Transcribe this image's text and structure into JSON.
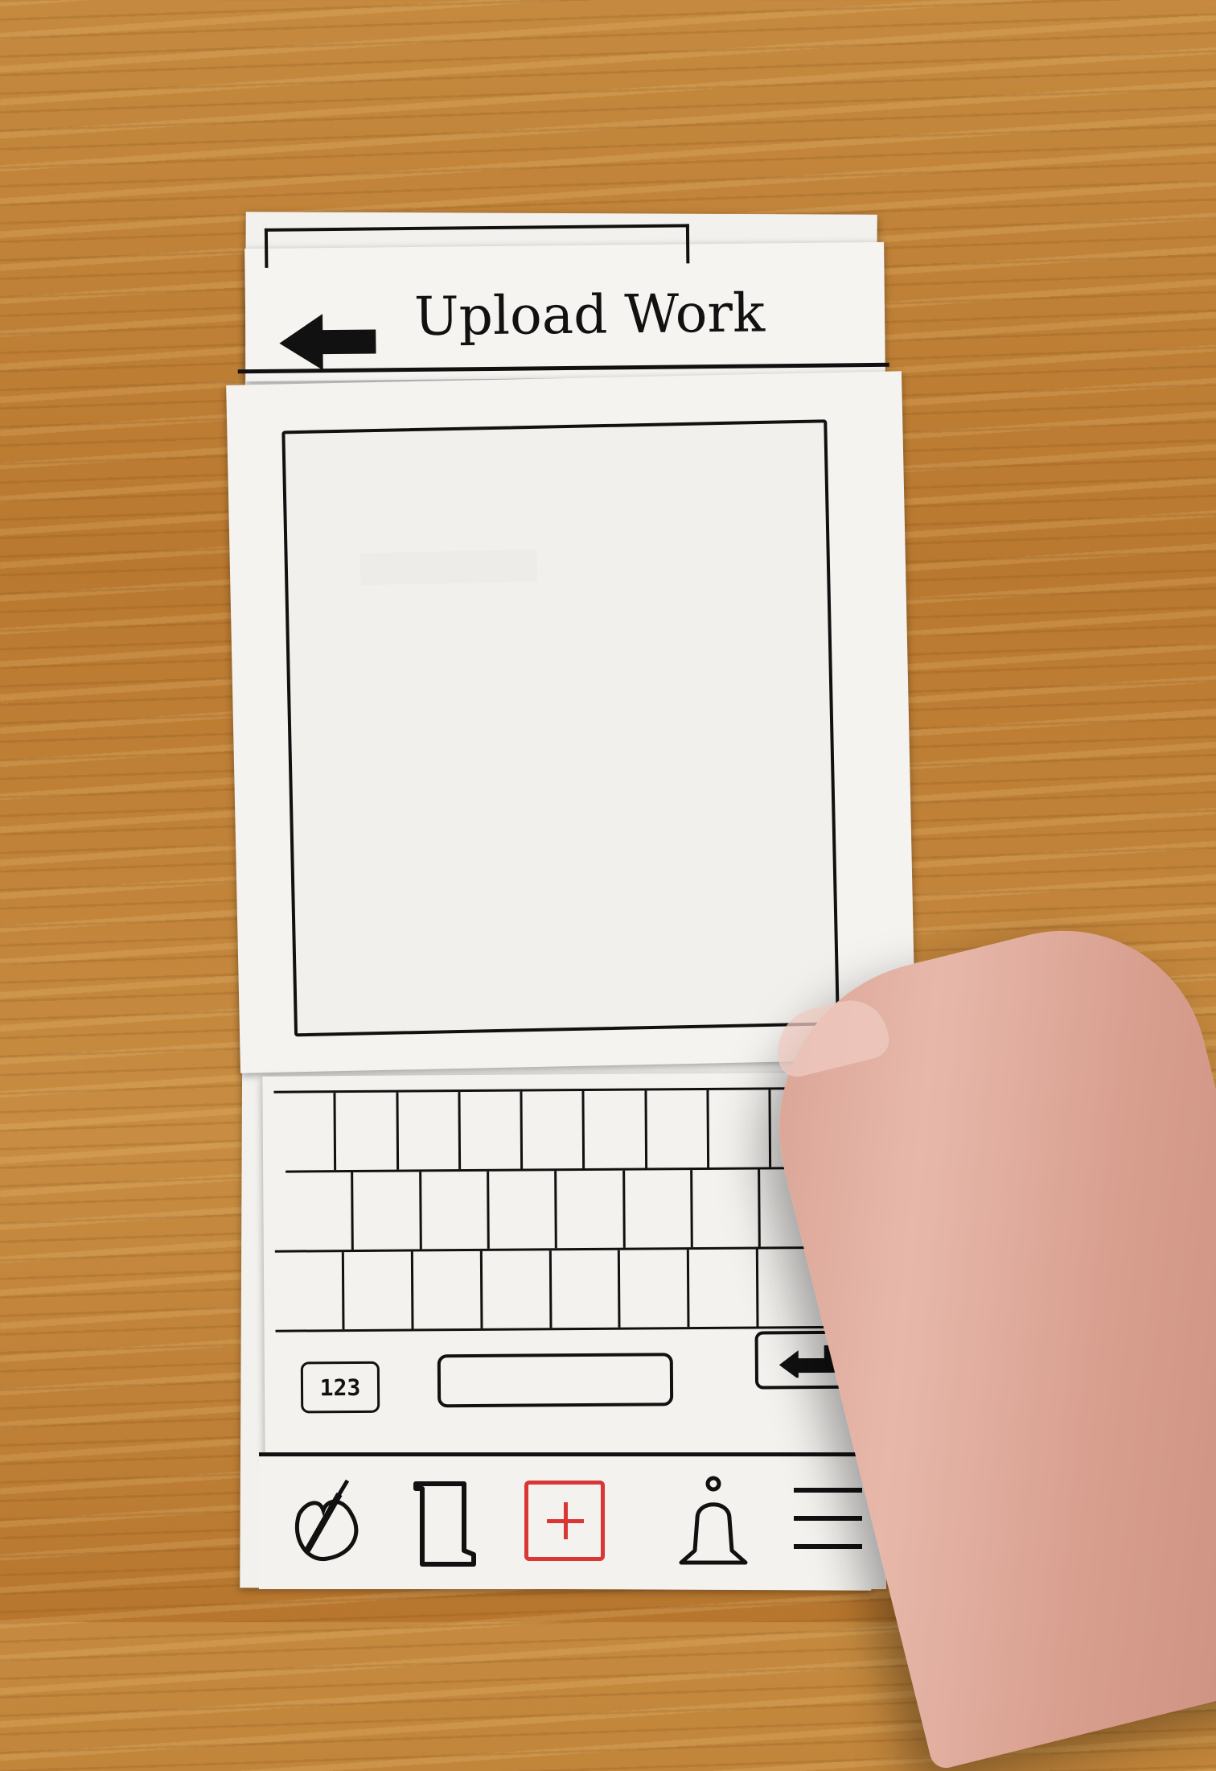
{
  "header": {
    "title": "Upload Work",
    "back_icon": "left-arrow-icon"
  },
  "preview": {
    "label": ""
  },
  "keyboard": {
    "numbers_key": "123",
    "return_icon": "return-icon"
  },
  "nav": {
    "items": [
      {
        "name": "home",
        "icon": "palette-icon"
      },
      {
        "name": "library",
        "icon": "scroll-icon"
      },
      {
        "name": "upload",
        "icon": "plus-square-icon"
      },
      {
        "name": "notifications",
        "icon": "bell-icon"
      },
      {
        "name": "menu",
        "icon": "hamburger-icon"
      }
    ]
  },
  "colors": {
    "accent": "#d93636",
    "ink": "#111111",
    "paper": "#f4f2ef",
    "wood": "#c58a3f"
  }
}
